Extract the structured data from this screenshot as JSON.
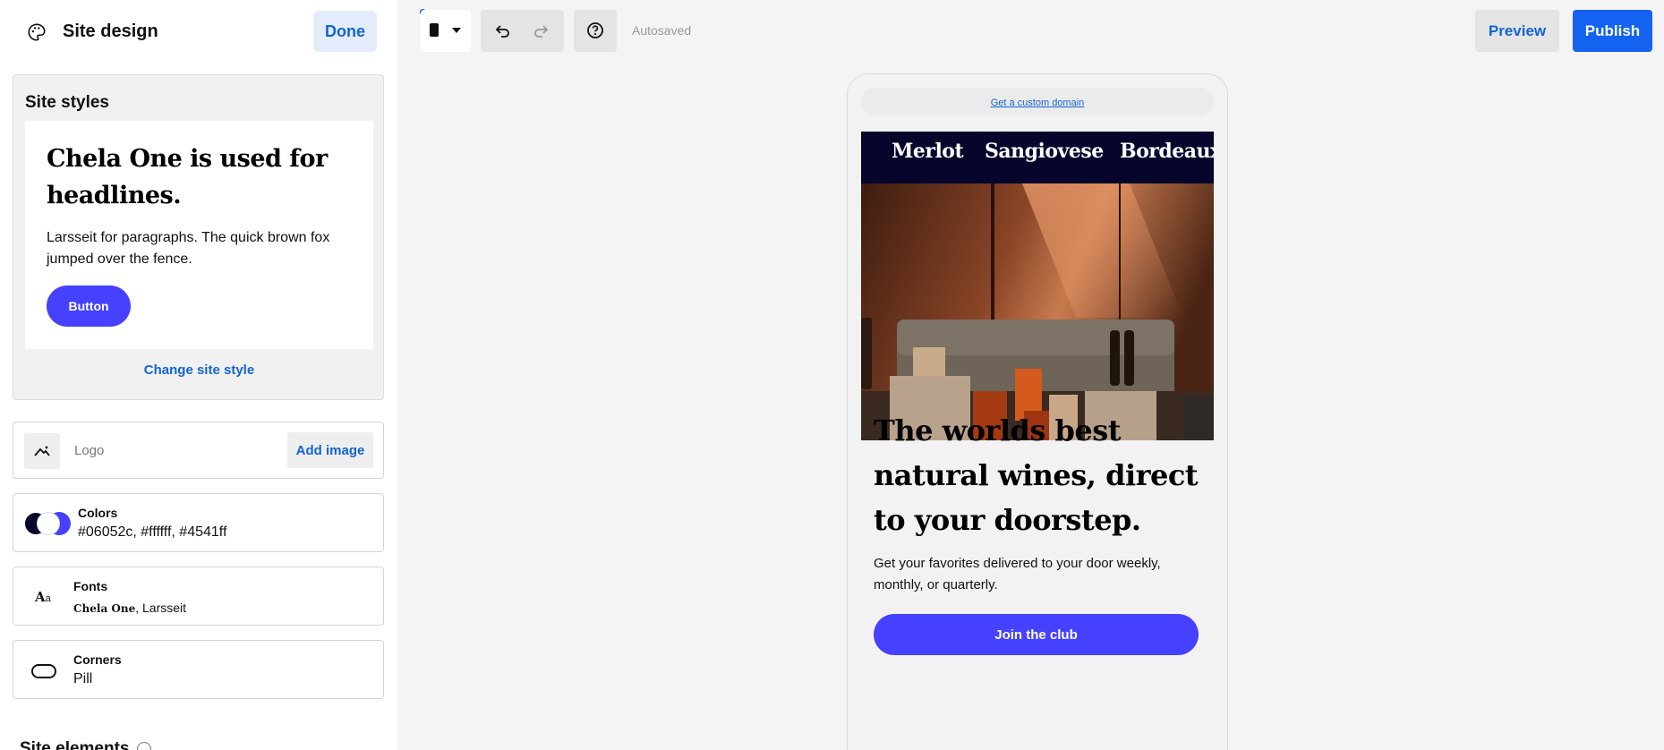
{
  "panel": {
    "title": "Site design",
    "done_label": "Done"
  },
  "site_styles": {
    "heading": "Site styles",
    "headline_text": "Chela One is used for headlines.",
    "paragraph_text": "Larsseit for paragraphs. The quick brown fox jumped over the fence.",
    "sample_button_label": "Button",
    "change_style_label": "Change site style"
  },
  "logo": {
    "label": "Logo",
    "add_image_label": "Add image"
  },
  "colors": {
    "title": "Colors",
    "value": "#06052c, #ffffff, #4541ff",
    "swatches": [
      "#06052c",
      "#ffffff",
      "#4541ff"
    ]
  },
  "fonts": {
    "title": "Fonts",
    "headline_font": "Chela One",
    "separator": ",",
    "body_font": "Larsseit",
    "icon_big": "A",
    "icon_small": "a"
  },
  "corners": {
    "title": "Corners",
    "value": "Pill"
  },
  "site_elements": {
    "heading": "Site elements"
  },
  "toolbar": {
    "autosaved": "Autosaved",
    "preview_label": "Preview",
    "publish_label": "Publish",
    "device_icon": "phone-icon",
    "undo_icon": "undo-icon",
    "redo_icon": "redo-icon",
    "help_icon": "help-circle-icon"
  },
  "preview": {
    "domain_link": "Get a custom domain",
    "nav_items": [
      "Merlot",
      "Sangiovese",
      "Bordeaux"
    ],
    "hero_heading": "The worlds best natural wines, direct to your doorstep.",
    "hero_subtext": "Get your favorites delivered to your door weekly, monthly, or quarterly.",
    "cta_label": "Join the club"
  },
  "colors_theme": {
    "accent": "#4541ff",
    "link_blue": "#1363d6",
    "publish_blue": "#1363f0",
    "nav_dark": "#06052c"
  }
}
